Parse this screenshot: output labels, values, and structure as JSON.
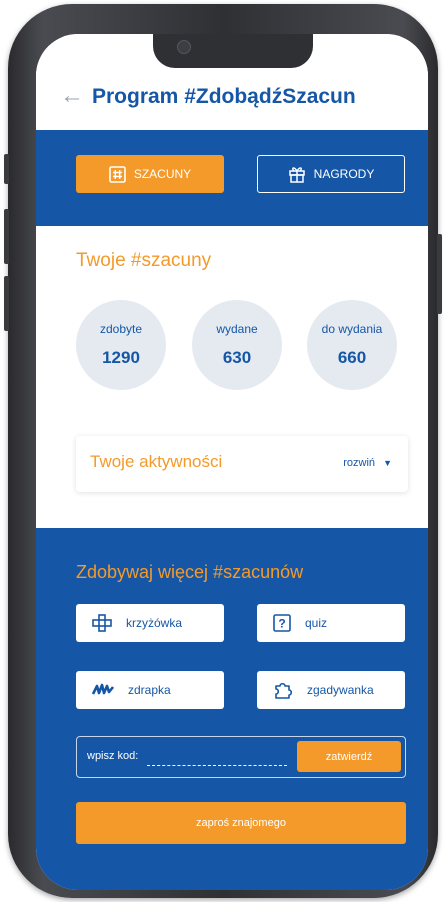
{
  "header": {
    "title": "Program #ZdobądźSzacun",
    "back_icon": "arrow-left-icon"
  },
  "tabs": [
    {
      "label": "SZACUNY",
      "icon": "hash-box-icon",
      "active": true
    },
    {
      "label": "NAGRODY",
      "icon": "gift-icon",
      "active": false
    }
  ],
  "points": {
    "section_title": "Twoje #szacuny",
    "stats": [
      {
        "label": "zdobyte",
        "value": "1290"
      },
      {
        "label": "wydane",
        "value": "630"
      },
      {
        "label": "do wydania",
        "value": "660"
      }
    ]
  },
  "activities": {
    "title": "Twoje aktywności",
    "expand_label": "rozwiń"
  },
  "earn": {
    "section_title": "Zdobywaj więcej #szacunów",
    "games": [
      {
        "label": "krzyżówka",
        "icon": "crossword-icon"
      },
      {
        "label": "quiz",
        "icon": "question-box-icon"
      },
      {
        "label": "zdrapka",
        "icon": "scratch-icon"
      },
      {
        "label": "zgadywanka",
        "icon": "puzzle-icon"
      }
    ],
    "code": {
      "label": "wpisz kod:",
      "value": "",
      "submit_label": "zatwierdź"
    },
    "invite_label": "zaproś znajomego"
  },
  "colors": {
    "brand_blue": "#1557a6",
    "accent_orange": "#f49a2a",
    "circle_bg": "#e5eaf1"
  }
}
